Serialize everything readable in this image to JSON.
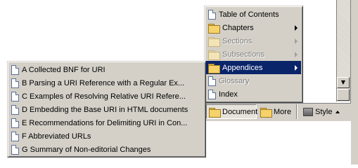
{
  "main_menu": {
    "items": [
      {
        "label": "Table of Contents",
        "icon": "document-icon",
        "submenu": false,
        "disabled": false,
        "selected": false
      },
      {
        "label": "Chapters",
        "icon": "folder-icon",
        "submenu": true,
        "disabled": false,
        "selected": false
      },
      {
        "label": "Sections",
        "icon": "folder-icon",
        "submenu": true,
        "disabled": true,
        "selected": false
      },
      {
        "label": "Subsections",
        "icon": "folder-icon",
        "submenu": true,
        "disabled": true,
        "selected": false
      },
      {
        "label": "Appendices",
        "icon": "folder-open-icon",
        "submenu": true,
        "disabled": false,
        "selected": true
      },
      {
        "label": "Glossary",
        "icon": "document-icon",
        "submenu": false,
        "disabled": true,
        "selected": false
      },
      {
        "label": "Index",
        "icon": "document-icon",
        "submenu": false,
        "disabled": false,
        "selected": false
      }
    ]
  },
  "submenu": {
    "items": [
      {
        "label": "A Collected BNF for URI"
      },
      {
        "label": "B Parsing a URI Reference with a Regular Ex..."
      },
      {
        "label": "C Examples of Resolving Relative URI Refere..."
      },
      {
        "label": "D Embedding the Base URI in HTML documents"
      },
      {
        "label": "E Recommendations for Delimiting URI in Con..."
      },
      {
        "label": "F Abbreviated URLs"
      },
      {
        "label": "G Summary of Non-editorial Changes"
      }
    ]
  },
  "toolbar": {
    "document_label": "Document",
    "more_label": "More",
    "style_label": "Style"
  },
  "colors": {
    "selection": "#0a246a",
    "menu_face": "#d4d0c8",
    "disabled_text": "#808080"
  }
}
